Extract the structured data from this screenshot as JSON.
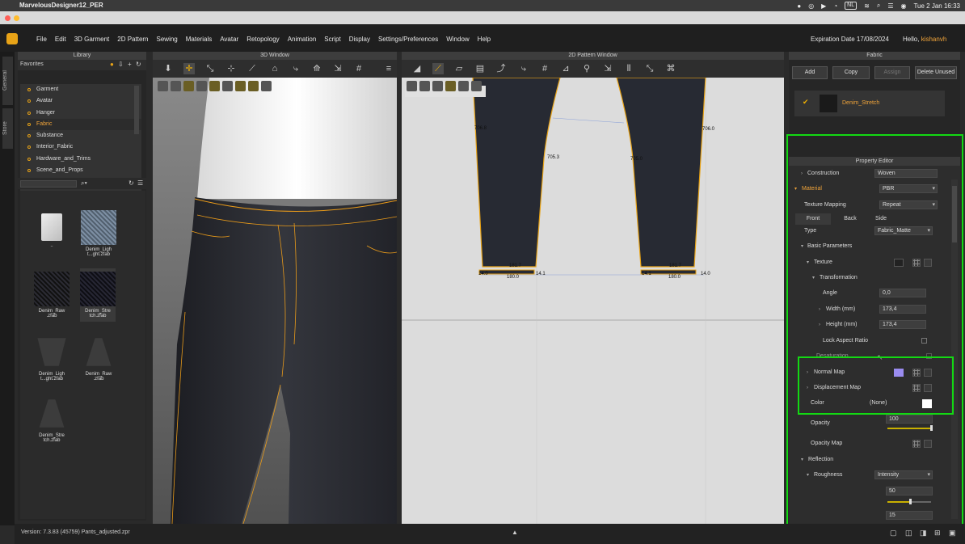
{
  "macbar": {
    "app": "MarvelousDesigner12_PER",
    "lang": "NL",
    "clock": "Tue 2 Jan  16:33"
  },
  "menu": [
    "File",
    "Edit",
    "3D Garment",
    "2D Pattern",
    "Sewing",
    "Materials",
    "Avatar",
    "Retopology",
    "Animation",
    "Script",
    "Display",
    "Settings/Preferences",
    "Window",
    "Help"
  ],
  "account": {
    "expiry": "Expiration Date 17/08/2024",
    "hello": "Hello, ",
    "user": "kishanvh"
  },
  "side_tabs": [
    "General",
    "Store"
  ],
  "library": {
    "title": "Library",
    "favorites_label": "Favorites",
    "tree": [
      "Garment",
      "Avatar",
      "Hanger",
      "Fabric",
      "Substance",
      "Interior_Fabric",
      "Hardware_and_Trims",
      "Scene_and_Props"
    ],
    "selected": "Fabric",
    "thumbs": [
      {
        "label": ".."
      },
      {
        "label": "Denim_Ligh t...ght.zfab"
      },
      {
        "label": "Denim_Raw .zfab"
      },
      {
        "label": "Denim_Stre tch.zfab"
      },
      {
        "label": "Denim_Ligh t...ght.zfab"
      },
      {
        "label": "Denim_Raw .zfab"
      },
      {
        "label": "Denim_Stre tch.zfab"
      }
    ]
  },
  "window3d": {
    "title": "3D Window"
  },
  "window2d": {
    "title": "2D Pattern Window",
    "labels": [
      "706.8",
      "705.3",
      "705.0",
      "706.0",
      "181.7",
      "180.0",
      "14.0",
      "14.1",
      "181.7",
      "180.0",
      "14.1",
      "14.0"
    ]
  },
  "fabric": {
    "title": "Fabric",
    "buttons": [
      "Add",
      "Copy",
      "Assign",
      "Delete Unused"
    ],
    "item": "Denim_Stretch"
  },
  "property_editor": {
    "title": "Property Editor",
    "construction": {
      "label": "Construction",
      "value": "Woven"
    },
    "material": {
      "label": "Material",
      "value": "PBR"
    },
    "texture_mapping": {
      "label": "Texture Mapping",
      "value": "Repeat"
    },
    "tabs": [
      "Front",
      "Back",
      "Side"
    ],
    "type": {
      "label": "Type",
      "value": "Fabric_Matte"
    },
    "basic_parameters": "Basic Parameters",
    "texture": "Texture",
    "transformation": "Transformation",
    "angle": {
      "label": "Angle",
      "value": "0,0"
    },
    "width": {
      "label": "Width (mm)",
      "value": "173,4"
    },
    "height": {
      "label": "Height (mm)",
      "value": "173,4"
    },
    "lock_aspect": "Lock Aspect Ratio",
    "desaturation": "Desaturation",
    "normal_map": "Normal Map",
    "displacement_map": "Displacement Map",
    "color": {
      "label": "Color",
      "value": "(None)"
    },
    "opacity": {
      "label": "Opacity",
      "value": "100"
    },
    "opacity_map": "Opacity Map",
    "reflection": "Reflection",
    "roughness": {
      "label": "Roughness",
      "value": "Intensity",
      "amount": "50"
    },
    "extra_value": "15"
  },
  "status": {
    "version": "Version:  7.3.83 (45759)   Pants_adjusted.zpr"
  },
  "colors": {
    "accent": "#f0a43a",
    "highlight": "#13d913",
    "normal_map_swatch": "#9a8cf0"
  }
}
